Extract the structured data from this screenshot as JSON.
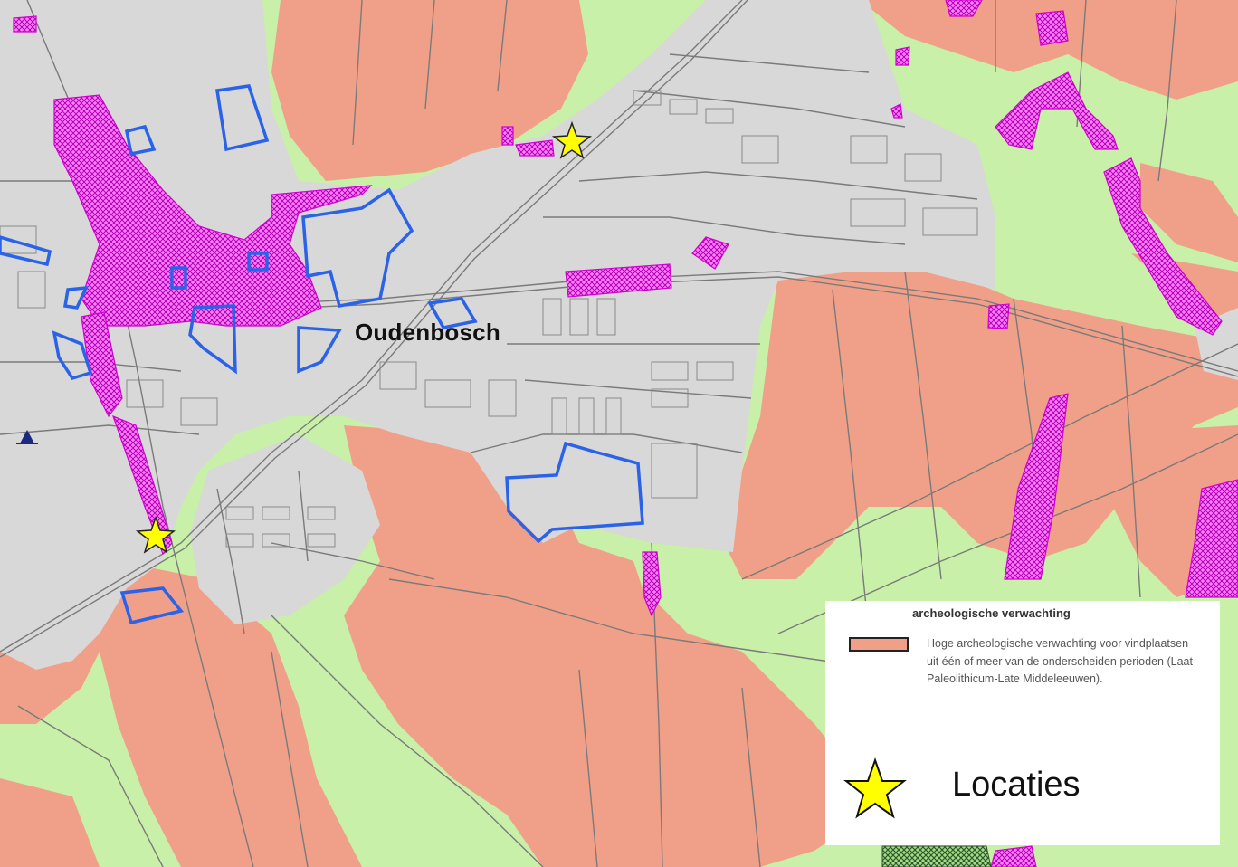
{
  "map": {
    "place_name": "Oudenbosch",
    "colors": {
      "background_green": "#c8f0a8",
      "high_expectation": "#f0a088",
      "built_area": "#d8d8d8",
      "street_lines": "#7a7a7a",
      "monument_hatch": "#e040e0",
      "blue_outline": "#2a62e8",
      "star_fill": "#ffff00"
    },
    "icons": [
      "star-icon",
      "triangle-marker-icon"
    ]
  },
  "legend": {
    "title": "archeologische verwachting",
    "entry_text": "Hoge archeologische verwachting voor vindplaatsen uit één of meer van de onderscheiden perioden (Laat-Paleolithicum-Late Middeleeuwen).",
    "star_label": "Locaties"
  }
}
